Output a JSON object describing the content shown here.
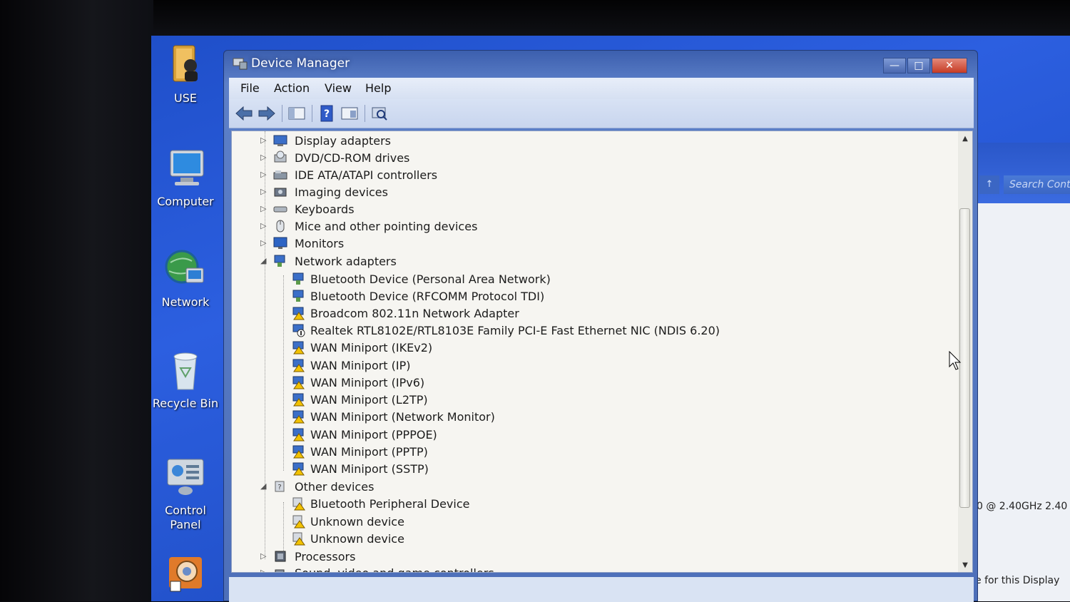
{
  "desktop": {
    "icons": [
      {
        "label": "USE",
        "icon": "folder-user-icon"
      },
      {
        "label": "Computer",
        "icon": "computer-icon"
      },
      {
        "label": "Network",
        "icon": "network-globe-icon"
      },
      {
        "label": "Recycle Bin",
        "icon": "recycle-bin-icon"
      },
      {
        "label_line1": "Control",
        "label_line2": "Panel",
        "icon": "control-panel-icon"
      },
      {
        "label": "",
        "icon": "shortcut-app-icon"
      }
    ]
  },
  "background_window": {
    "search_placeholder": "Search Contr",
    "nav_glyph": "↑",
    "cpu_text": "0 @ 2.40GHz   2.40",
    "display_text": "e for this Display"
  },
  "window": {
    "title": "Device Manager",
    "caption": {
      "minimize": "—",
      "maximize": "□",
      "close": "✕"
    },
    "menu": {
      "file": "File",
      "action": "Action",
      "view": "View",
      "help": "Help"
    },
    "toolbar": {
      "back": "back-arrow-icon",
      "forward": "forward-arrow-icon",
      "show_hide": "console-tree-icon",
      "help": "help-icon",
      "properties": "properties-icon",
      "scan": "scan-hardware-icon"
    },
    "tree": {
      "categories": {
        "display_adapters": "Display adapters",
        "dvd_cdrom": "DVD/CD-ROM drives",
        "ide_atapi": "IDE ATA/ATAPI controllers",
        "imaging": "Imaging devices",
        "keyboards": "Keyboards",
        "mice": "Mice and other pointing devices",
        "monitors": "Monitors",
        "network_adapters": "Network adapters",
        "other_devices": "Other devices",
        "processors": "Processors",
        "sound": "Sound, video and game controllers"
      },
      "network_children": [
        "Bluetooth Device (Personal Area Network)",
        "Bluetooth Device (RFCOMM Protocol TDI)",
        "Broadcom 802.11n Network Adapter",
        "Realtek RTL8102E/RTL8103E Family PCI-E Fast Ethernet NIC (NDIS 6.20)",
        "WAN Miniport (IKEv2)",
        "WAN Miniport (IP)",
        "WAN Miniport (IPv6)",
        "WAN Miniport (L2TP)",
        "WAN Miniport (Network Monitor)",
        "WAN Miniport (PPPOE)",
        "WAN Miniport (PPTP)",
        "WAN Miniport (SSTP)"
      ],
      "other_children": [
        "Bluetooth Peripheral Device",
        "Unknown device",
        "Unknown device"
      ],
      "expander_collapsed": "▷",
      "expander_expanded": "◢"
    },
    "scrollbar": {
      "up": "▲",
      "down": "▼"
    }
  }
}
